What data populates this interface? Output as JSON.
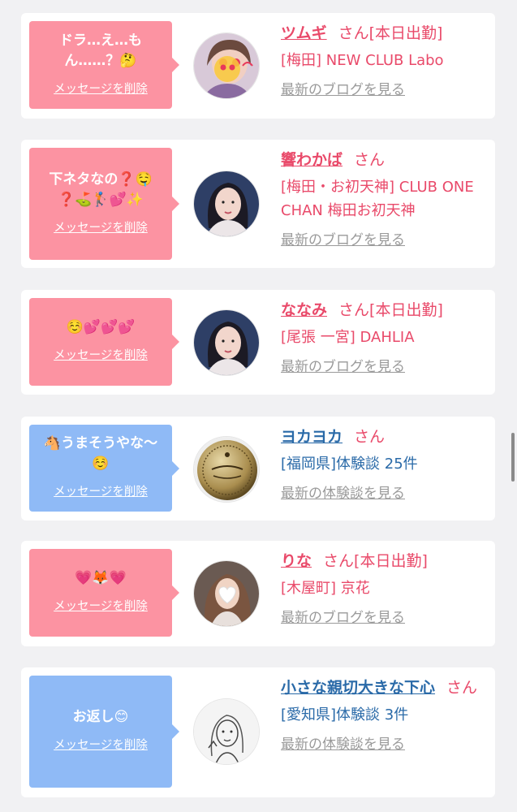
{
  "colors": {
    "pink_bubble": "#fc93a2",
    "blue_bubble": "#8fbaf6",
    "pink_text": "#e94a6a",
    "blue_text": "#2a6aa8",
    "link_gray": "#9a9a9a"
  },
  "cards": [
    {
      "theme": "pink",
      "message": "ドラ…え…も\nん……？🤔",
      "delete_label": "メッセージを削除",
      "avatar_icon": "woman-photo-heart-eyes-icon",
      "name": "ツムギ",
      "honorific": "さん",
      "status": "[本日出勤]",
      "shop": "[梅田] NEW CLUB Labo",
      "link": "最新のブログを見る"
    },
    {
      "theme": "pink",
      "message": "下ネタなの❓🤤\n❓⛳🏌💕✨",
      "delete_label": "メッセージを削除",
      "avatar_icon": "woman-photo-icon",
      "name": "響わかば",
      "honorific": "さん",
      "status": "",
      "shop": "[梅田・お初天神] CLUB ONE CHAN 梅田お初天神",
      "link": "最新のブログを見る"
    },
    {
      "theme": "pink",
      "message": "☺️💕💕💕",
      "delete_label": "メッセージを削除",
      "avatar_icon": "woman-photo-icon",
      "name": "ななみ",
      "honorific": "さん",
      "status": "[本日出勤]",
      "shop": "[尾張 一宮] DAHLIA",
      "link": "最新のブログを見る"
    },
    {
      "theme": "blue",
      "message": "🐴うまそうやな〜\n☺️",
      "delete_label": "メッセージを削除",
      "avatar_icon": "coin-medal-icon",
      "name": "ヨカヨカ",
      "honorific": "さん",
      "status": "",
      "shop": "[福岡県]体験談 25件",
      "link": "最新の体験談を見る"
    },
    {
      "theme": "pink",
      "message": "💗🦊💗",
      "delete_label": "メッセージを削除",
      "avatar_icon": "woman-photo-heart-face-icon",
      "name": "りな",
      "honorific": "さん",
      "status": "[本日出勤]",
      "shop": "[木屋町] 京花",
      "link": "最新のブログを見る"
    },
    {
      "theme": "blue",
      "message": "お返し😊",
      "delete_label": "メッセージを削除",
      "avatar_icon": "sketch-drawing-icon",
      "name": "小さな親切大きな下心",
      "honorific": "さん",
      "status": "",
      "shop": "[愛知県]体験談 3件",
      "link": "最新の体験談を見る"
    }
  ]
}
